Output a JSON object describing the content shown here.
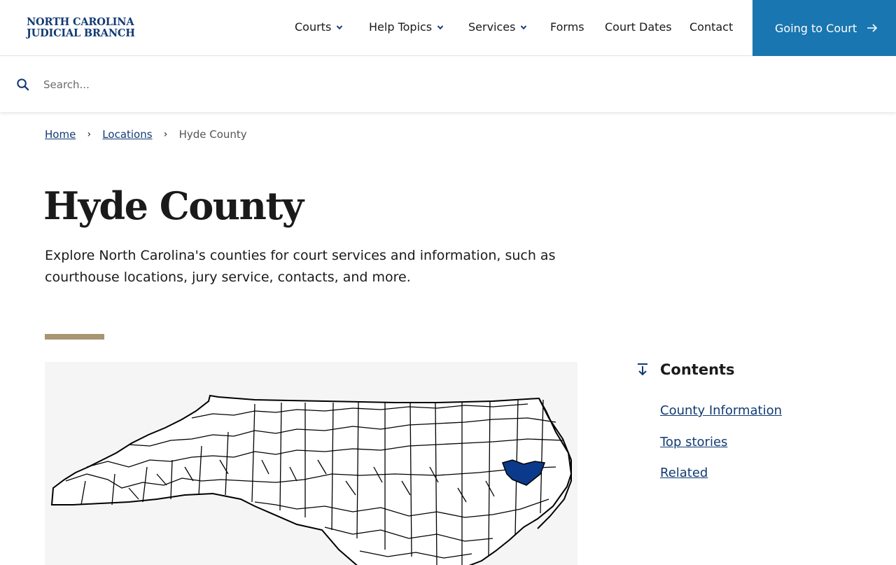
{
  "brand": {
    "line1": "NORTH CAROLINA",
    "line2": "JUDICIAL BRANCH"
  },
  "nav": {
    "items": [
      {
        "label": "Courts",
        "has_dropdown": true
      },
      {
        "label": "Help Topics",
        "has_dropdown": true
      },
      {
        "label": "Services",
        "has_dropdown": true
      },
      {
        "label": "Forms",
        "has_dropdown": false
      },
      {
        "label": "Court Dates",
        "has_dropdown": false
      },
      {
        "label": "Contact",
        "has_dropdown": false
      }
    ],
    "cta_label": "Going to Court"
  },
  "search": {
    "placeholder": "Search...",
    "value": ""
  },
  "breadcrumb": {
    "home": "Home",
    "locations": "Locations",
    "current": "Hyde County"
  },
  "page": {
    "title": "Hyde County",
    "intro": "Explore North Carolina's counties for court services and information, such as courthouse locations, jury service, contacts, and more."
  },
  "contents": {
    "heading": "Contents",
    "links": [
      "County Information",
      "Top stories",
      "Related"
    ]
  },
  "colors": {
    "brand_blue": "#123b73",
    "cta_blue": "#1a76b0",
    "accent_tan": "#a89571",
    "highlight_county": "#0b3a8c"
  }
}
